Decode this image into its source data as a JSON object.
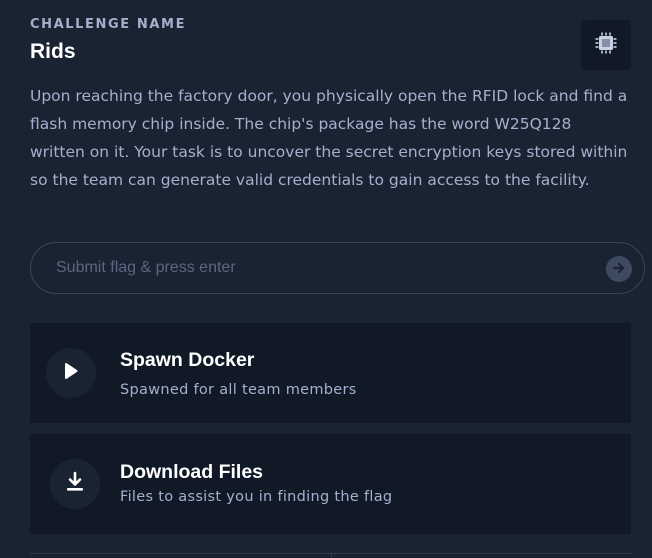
{
  "challenge": {
    "label": "CHALLENGE NAME",
    "name": "Rids",
    "category_icon": "chip-icon",
    "description": "Upon reaching the factory door, you physically open the RFID lock and find a flash memory chip inside. The chip's package has the word W25Q128 written on it. Your task is to uncover the secret encryption keys stored within so the team can generate valid credentials to gain access to the facility."
  },
  "flag_input": {
    "value": "",
    "placeholder": "Submit flag & press enter",
    "submit_icon": "arrow-right-icon"
  },
  "actions": [
    {
      "title": "Spawn Docker",
      "subtitle": "Spawned for all team members",
      "icon": "play-icon"
    },
    {
      "title": "Download Files",
      "subtitle": "Files to assist you in finding the flag",
      "icon": "download-icon"
    }
  ],
  "colors": {
    "background": "#1a2332",
    "card": "#111927",
    "muted_text": "#a4b1cd",
    "border": "#3a4659"
  }
}
